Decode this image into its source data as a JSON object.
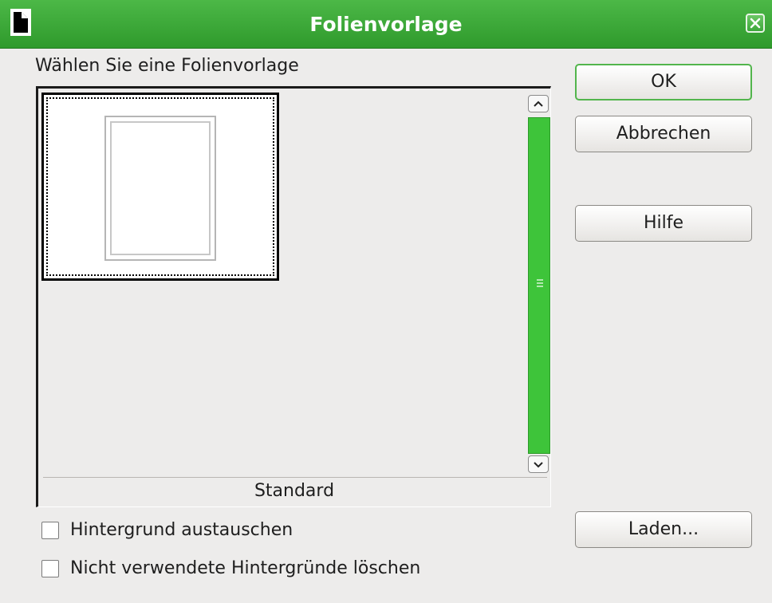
{
  "window": {
    "title": "Folienvorlage"
  },
  "icons": {
    "app": "document-icon",
    "close": "close-icon",
    "scroll_up": "chevron-up-icon",
    "scroll_down": "chevron-down-icon"
  },
  "main": {
    "prompt_label": "Wählen Sie eine Folienvorlage",
    "selected_template_caption": "Standard"
  },
  "buttons": {
    "ok": "OK",
    "cancel": "Abbrechen",
    "help": "Hilfe",
    "load": "Laden..."
  },
  "options": [
    {
      "label": "Hintergrund austauschen",
      "checked": false
    },
    {
      "label": "Nicht verwendete Hintergründe löschen",
      "checked": false
    }
  ],
  "colors": {
    "titlebar": "#3ca938",
    "scroll_thumb": "#3ec43a",
    "default_button_border": "#52b54c"
  }
}
